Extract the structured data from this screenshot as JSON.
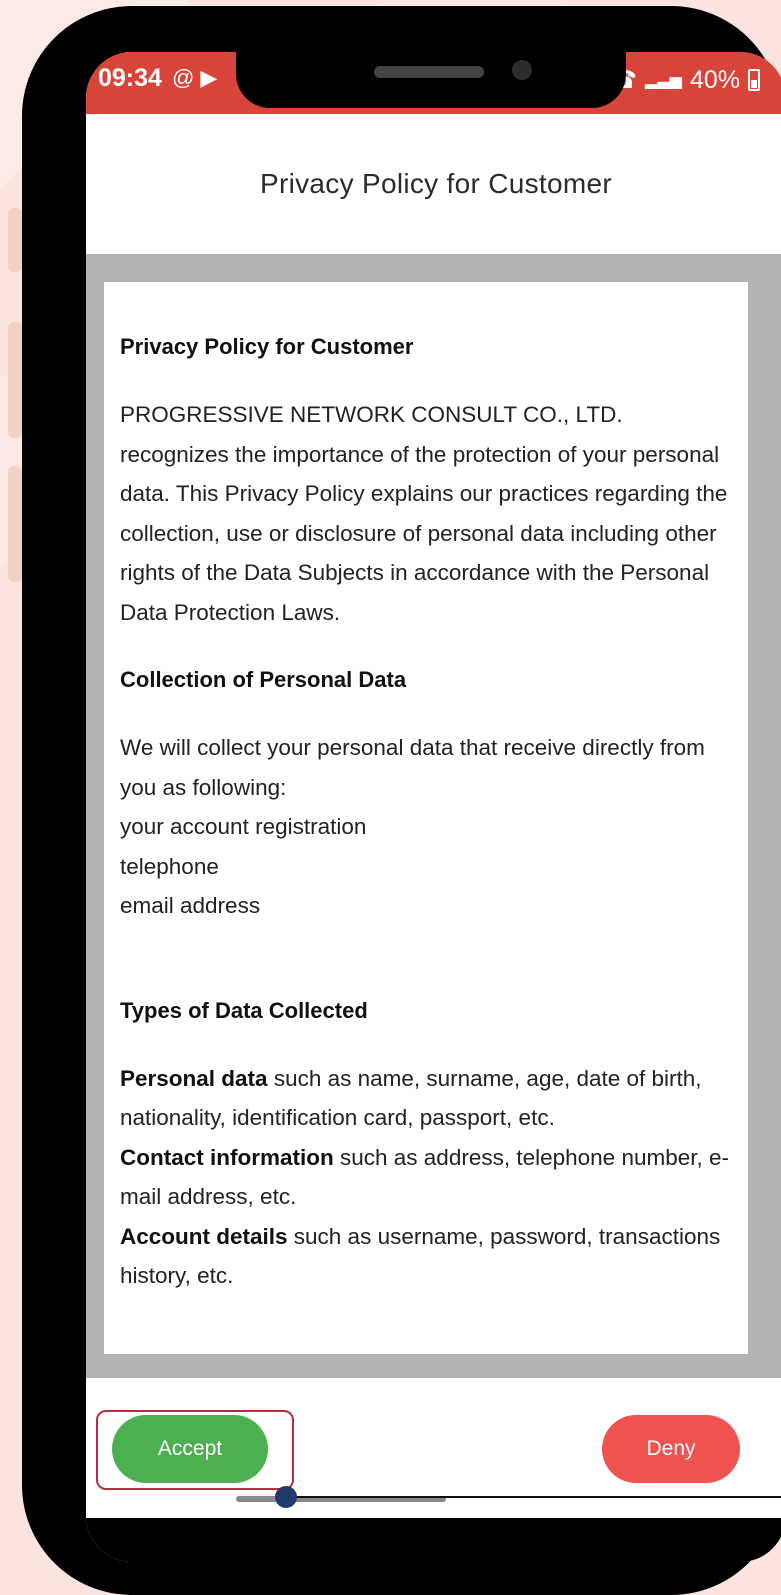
{
  "status_bar": {
    "time": "09:34",
    "battery": "40%",
    "left_icons": [
      "at-sign-icon",
      "youtube-icon"
    ],
    "right_icons": [
      "wifi-call-icon",
      "signal-icon",
      "battery-icon"
    ]
  },
  "header": {
    "title": "Privacy Policy for Customer"
  },
  "document": {
    "heading1": "Privacy Policy for Customer",
    "para1": "PROGRESSIVE NETWORK CONSULT CO., LTD. recognizes the importance of the protection of your personal data. This Privacy Policy explains our practices regarding the collection, use or disclosure of personal data including other rights of the Data Subjects in accordance with the Personal Data Protection Laws.",
    "heading2": "Collection of Personal Data",
    "para2": "We will collect your personal data that receive directly from you as following:",
    "list": [
      "your account registration",
      "telephone",
      "email address"
    ],
    "heading3": "Types of Data Collected",
    "types": [
      {
        "label": "Personal data",
        "text": " such as name, surname, age, date of birth, nationality, identification card, passport, etc."
      },
      {
        "label": "Contact information",
        "text": " such as address, telephone number, e-mail address, etc."
      },
      {
        "label": "Account details",
        "text": " such as username, password, transactions history, etc."
      }
    ]
  },
  "actions": {
    "accept_label": "Accept",
    "deny_label": "Deny"
  },
  "colors": {
    "status_bar": "#d8443a",
    "accept": "#4caf50",
    "deny": "#ef5350",
    "highlight": "#b5303a",
    "pointer": "#1f3a6b"
  }
}
